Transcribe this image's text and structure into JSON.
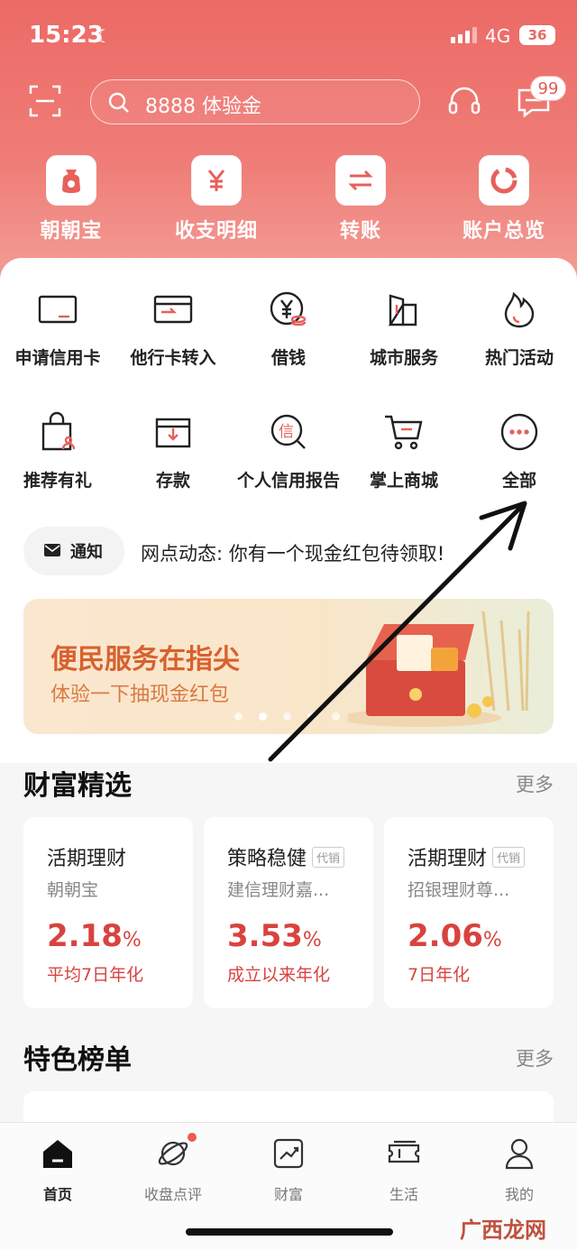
{
  "status": {
    "time": "15:23",
    "network": "4G",
    "battery": "36"
  },
  "header": {
    "search_placeholder": "8888 体验金",
    "message_badge": "99"
  },
  "quick_actions": [
    {
      "label": "朝朝宝",
      "icon": "money-bag-icon"
    },
    {
      "label": "收支明细",
      "icon": "yuan-icon"
    },
    {
      "label": "转账",
      "icon": "transfer-icon"
    },
    {
      "label": "账户总览",
      "icon": "pie-chart-icon"
    }
  ],
  "services": [
    {
      "label": "申请信用卡",
      "icon": "credit-card-icon"
    },
    {
      "label": "他行卡转入",
      "icon": "card-transfer-icon"
    },
    {
      "label": "借钱",
      "icon": "loan-icon"
    },
    {
      "label": "城市服务",
      "icon": "building-icon"
    },
    {
      "label": "热门活动",
      "icon": "fire-icon"
    },
    {
      "label": "推荐有礼",
      "icon": "shopping-bag-icon"
    },
    {
      "label": "存款",
      "icon": "deposit-icon"
    },
    {
      "label": "个人信用报告",
      "icon": "credit-report-icon"
    },
    {
      "label": "掌上商城",
      "icon": "cart-icon"
    },
    {
      "label": "全部",
      "icon": "more-icon"
    }
  ],
  "notice": {
    "label": "通知",
    "text": "网点动态: 你有一个现金红包待领取!"
  },
  "banner": {
    "title": "便民服务在指尖",
    "subtitle": "体验一下抽现金红包"
  },
  "wealth": {
    "title": "财富精选",
    "more": "更多",
    "products": [
      {
        "name": "活期理财",
        "tag": "",
        "sub": "朝朝宝",
        "rate": "2.18",
        "unit": "%",
        "desc": "平均7日年化"
      },
      {
        "name": "策略稳健",
        "tag": "代销",
        "sub": "建信理财嘉...",
        "rate": "3.53",
        "unit": "%",
        "desc": "成立以来年化"
      },
      {
        "name": "活期理财",
        "tag": "代销",
        "sub": "招银理财尊...",
        "rate": "2.06",
        "unit": "%",
        "desc": "7日年化"
      }
    ]
  },
  "featured": {
    "title": "特色榜单",
    "more": "更多"
  },
  "tabs": [
    {
      "label": "首页",
      "icon": "home-icon"
    },
    {
      "label": "收盘点评",
      "icon": "planet-icon"
    },
    {
      "label": "财富",
      "icon": "chart-icon"
    },
    {
      "label": "生活",
      "icon": "ticket-icon"
    },
    {
      "label": "我的",
      "icon": "user-icon"
    }
  ],
  "watermark": "广西龙网",
  "colors": {
    "brand_red": "#e8605b",
    "rate_red": "#d8433f"
  }
}
